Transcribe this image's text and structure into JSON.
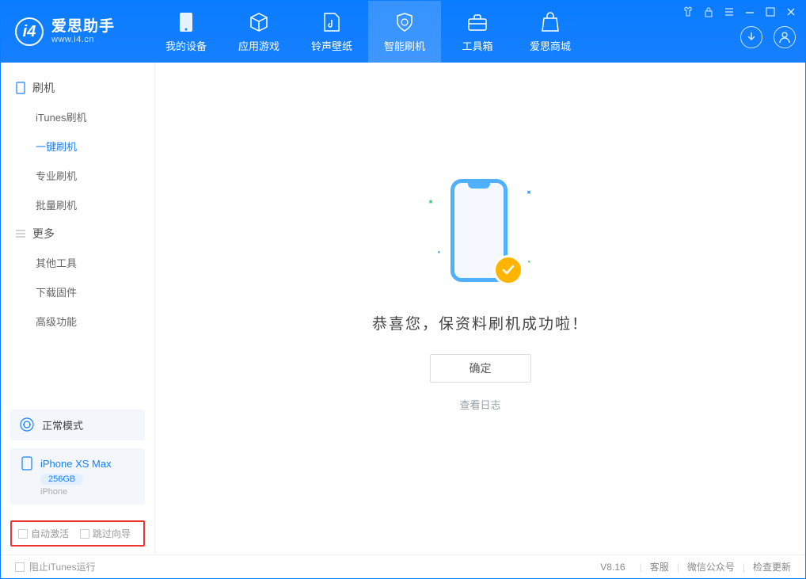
{
  "app": {
    "name": "爱思助手",
    "domain": "www.i4.cn"
  },
  "nav": [
    {
      "label": "我的设备",
      "icon": "device"
    },
    {
      "label": "应用游戏",
      "icon": "cube"
    },
    {
      "label": "铃声壁纸",
      "icon": "music"
    },
    {
      "label": "智能刷机",
      "icon": "shield",
      "active": true
    },
    {
      "label": "工具箱",
      "icon": "toolbox"
    },
    {
      "label": "爱思商城",
      "icon": "bag"
    }
  ],
  "sidebar": {
    "groups": [
      {
        "title": "刷机",
        "icon": "phone",
        "items": [
          "iTunes刷机",
          "一键刷机",
          "专业刷机",
          "批量刷机"
        ],
        "activeIndex": 1
      },
      {
        "title": "更多",
        "icon": "menu",
        "items": [
          "其他工具",
          "下载固件",
          "高级功能"
        ]
      }
    ]
  },
  "devicePanel": {
    "mode": "正常模式",
    "name": "iPhone XS Max",
    "capacity": "256GB",
    "type": "iPhone"
  },
  "checkboxes": {
    "auto_activate": "自动激活",
    "skip_wizard": "跳过向导"
  },
  "main": {
    "success_text": "恭喜您，保资料刷机成功啦！",
    "confirm_label": "确定",
    "log_link": "查看日志"
  },
  "footer": {
    "block_itunes": "阻止iTunes运行",
    "version": "V8.16",
    "links": [
      "客服",
      "微信公众号",
      "检查更新"
    ]
  }
}
